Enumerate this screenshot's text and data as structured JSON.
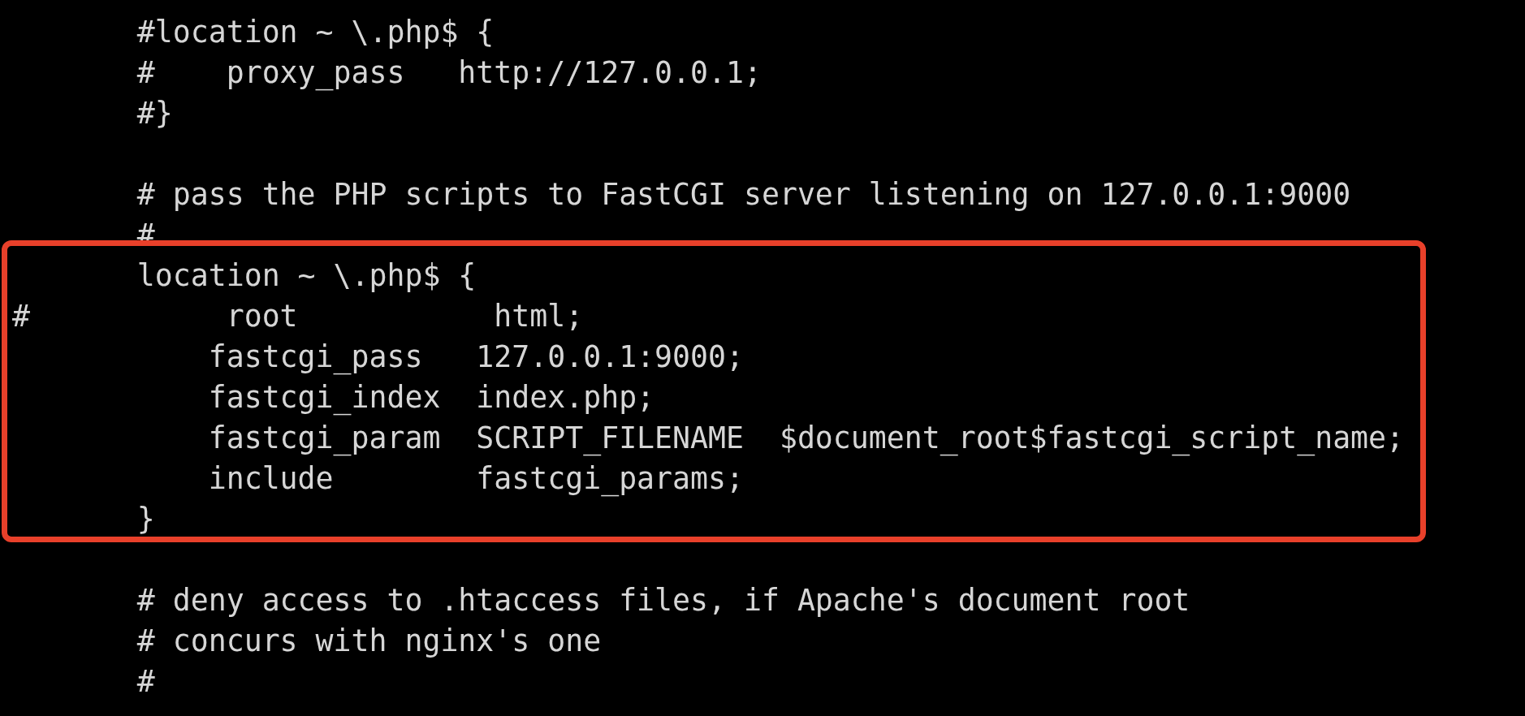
{
  "editor": {
    "lines": [
      {
        "kind": "code",
        "text": "       #location ~ \\.php$ {"
      },
      {
        "kind": "code",
        "text": "       #    proxy_pass   http://127.0.0.1;"
      },
      {
        "kind": "code",
        "text": "       #}"
      },
      {
        "kind": "blank"
      },
      {
        "kind": "code",
        "text": "       # pass the PHP scripts to FastCGI server listening on 127.0.0.1:9000"
      },
      {
        "kind": "code",
        "text": "       #"
      },
      {
        "kind": "code",
        "text": "       location ~ \\.php$ {"
      },
      {
        "kind": "code",
        "text": "#           root           html;"
      },
      {
        "kind": "code",
        "text": "           fastcgi_pass   127.0.0.1:9000;"
      },
      {
        "kind": "code",
        "text": "           fastcgi_index  index.php;"
      },
      {
        "kind": "code",
        "text": "           fastcgi_param  SCRIPT_FILENAME  $document_root$fastcgi_script_name;"
      },
      {
        "kind": "code",
        "text": "           include        fastcgi_params;"
      },
      {
        "kind": "code",
        "text": "       }"
      },
      {
        "kind": "blank"
      },
      {
        "kind": "code",
        "text": "       # deny access to .htaccess files, if Apache's document root"
      },
      {
        "kind": "code",
        "text": "       # concurs with nginx's one"
      },
      {
        "kind": "code",
        "text": "       #"
      }
    ]
  }
}
